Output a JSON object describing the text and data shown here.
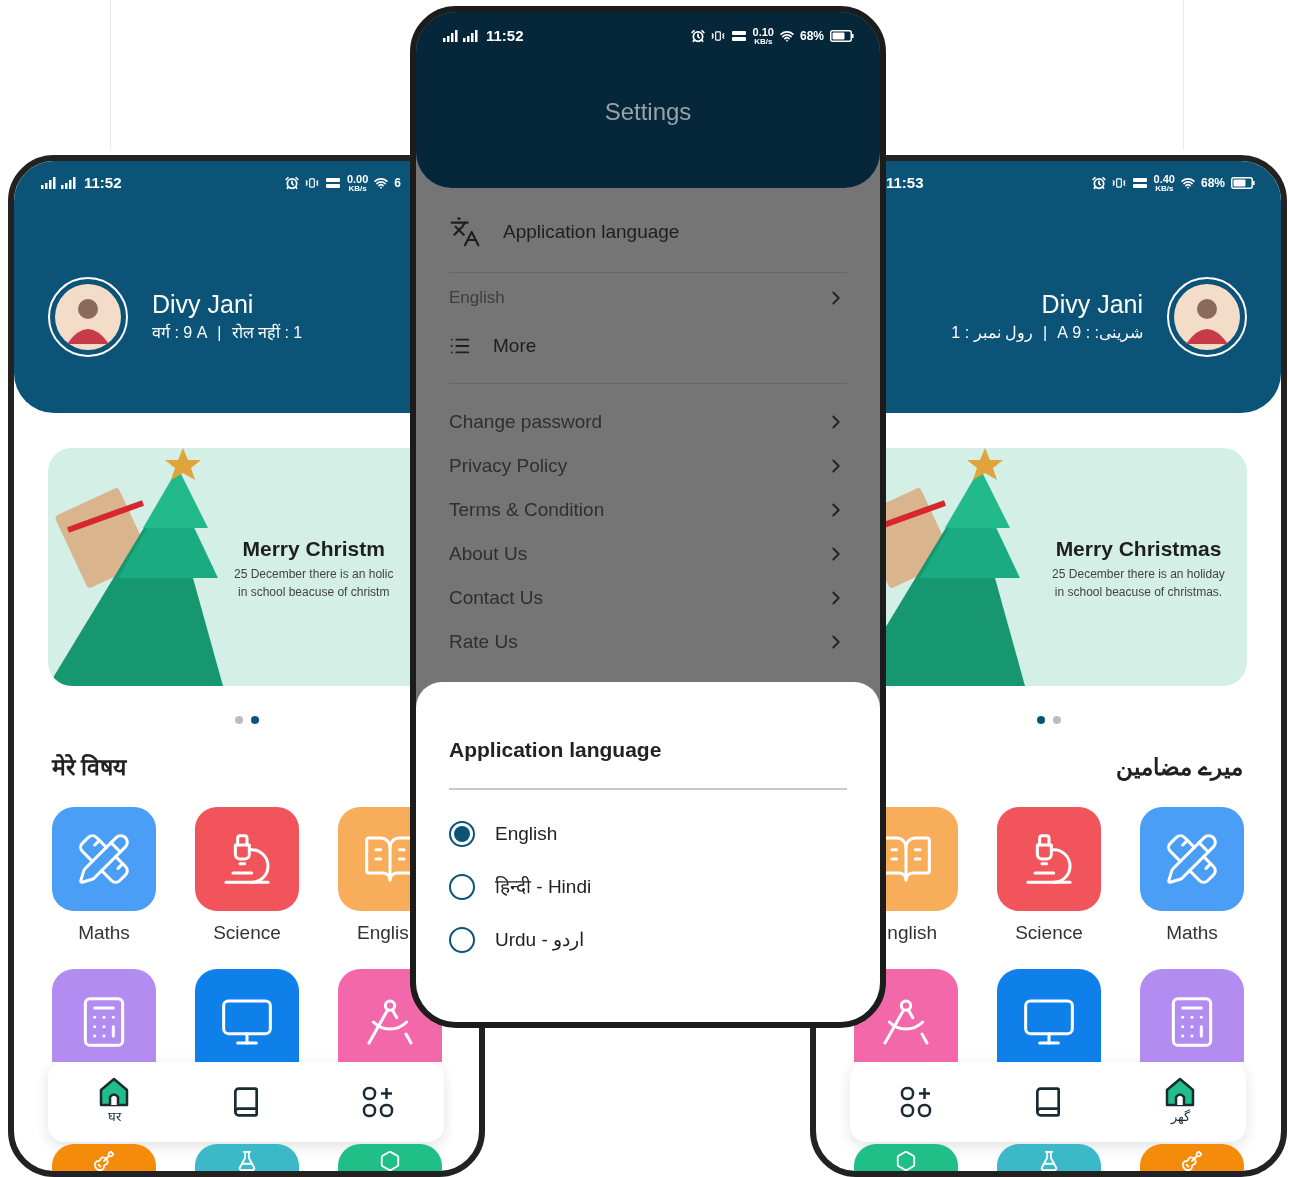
{
  "left_phone": {
    "rtl": false,
    "status": {
      "time": "11:52",
      "speed": "0.00",
      "speed_unit": "KB/s",
      "battery": "6",
      "battery_icon": false
    },
    "profile": {
      "name": "Divy Jani",
      "details": [
        "वर्ग : 9 A",
        "रोल नहीं : 1"
      ],
      "separator": "|"
    },
    "banner": {
      "title": "Merry Christm",
      "lines": [
        "25 December there is an holic",
        "in school beacuse of christm"
      ]
    },
    "dots": [
      {
        "selected": false
      },
      {
        "selected": true
      }
    ],
    "section_title": "मेरे विषय",
    "subjects": [
      {
        "kind": "maths",
        "label": "Maths",
        "color": "#4a9ef5"
      },
      {
        "kind": "science",
        "label": "Science",
        "color": "#f2545b"
      },
      {
        "kind": "english",
        "label": "Englis",
        "color": "#f8ad5a"
      },
      {
        "kind": "accounts",
        "color": "#b38cf2"
      },
      {
        "kind": "computer",
        "color": "#0f7fe9"
      },
      {
        "kind": "drawing",
        "color": "#f368ab"
      },
      {
        "kind": "music",
        "color": "#f58b0a"
      },
      {
        "kind": "lab",
        "color": "#3cb9c9"
      },
      {
        "kind": "geography",
        "color": "#20bf87"
      }
    ],
    "nav": [
      {
        "kind": "home",
        "label": "घर",
        "selected": true
      },
      {
        "kind": "book",
        "selected": false
      },
      {
        "kind": "apps",
        "selected": false
      }
    ]
  },
  "settings_phone": {
    "status": {
      "time": "11:52",
      "speed": "0.10",
      "speed_unit": "KB/s",
      "battery": "68%",
      "battery_icon": true
    },
    "title": "Settings",
    "language_row": {
      "label": "Application language",
      "value": "English"
    },
    "more": "More",
    "items": [
      "Change password",
      "Privacy Policy",
      "Terms & Condition",
      "About Us",
      "Contact Us",
      "Rate Us"
    ],
    "sheet": {
      "title": "Application language",
      "options": [
        {
          "label": "English",
          "selected": true
        },
        {
          "label": "हिन्दी - Hindi",
          "selected": false
        },
        {
          "label": "اردو - Urdu",
          "selected": false
        }
      ]
    }
  },
  "right_phone": {
    "rtl": true,
    "status": {
      "time": "11:53",
      "speed": "0.40",
      "speed_unit": "KB/s",
      "battery": "68%",
      "battery_icon": true
    },
    "profile": {
      "name": "Divy Jani",
      "details": [
        "شرینی: : 9 A",
        "رول نمبر : 1"
      ],
      "separator": "|"
    },
    "banner": {
      "title": "Merry Christmas",
      "lines": [
        "25 December there is an holiday",
        "in school beacuse of christmas."
      ]
    },
    "dots": [
      {
        "selected": true
      },
      {
        "selected": false
      }
    ],
    "section_title": "میرے مضامین",
    "subjects": [
      {
        "kind": "english",
        "label": "nglish",
        "color": "#f8ad5a"
      },
      {
        "kind": "science",
        "label": "Science",
        "color": "#f2545b"
      },
      {
        "kind": "maths",
        "label": "Maths",
        "color": "#4a9ef5"
      },
      {
        "kind": "drawing",
        "color": "#f368ab"
      },
      {
        "kind": "computer",
        "color": "#0f7fe9"
      },
      {
        "kind": "accounts",
        "color": "#b38cf2"
      },
      {
        "kind": "geography",
        "color": "#20bf87"
      },
      {
        "kind": "lab",
        "color": "#3cb9c9"
      },
      {
        "kind": "music",
        "color": "#f58b0a"
      }
    ],
    "nav": [
      {
        "kind": "apps",
        "selected": false
      },
      {
        "kind": "book",
        "selected": false
      },
      {
        "kind": "home",
        "label": "گھر",
        "selected": true
      }
    ]
  }
}
